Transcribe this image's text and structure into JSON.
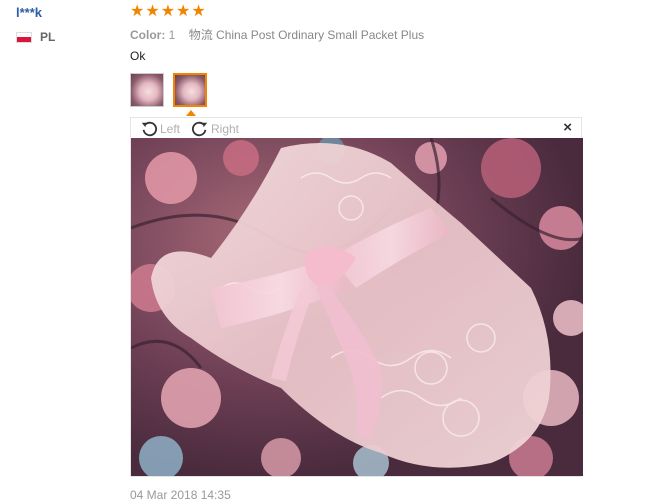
{
  "reviewer": {
    "name": "l***k",
    "country_code": "PL"
  },
  "rating": {
    "stars": 5,
    "max": 5
  },
  "meta": {
    "color_label": "Color:",
    "color_value": "1",
    "shipping": "物流 China Post Ordinary Small Packet Plus"
  },
  "review": {
    "text": "Ok"
  },
  "thumbnails": {
    "count": 2,
    "active_index": 1
  },
  "viewer": {
    "rotate_left_label": "Left",
    "rotate_right_label": "Right",
    "close_symbol": "×"
  },
  "footer": {
    "date": "04 Mar 2018 14:35"
  },
  "colors": {
    "link": "#2e5ca8",
    "star": "#f38400",
    "muted": "#999999"
  }
}
